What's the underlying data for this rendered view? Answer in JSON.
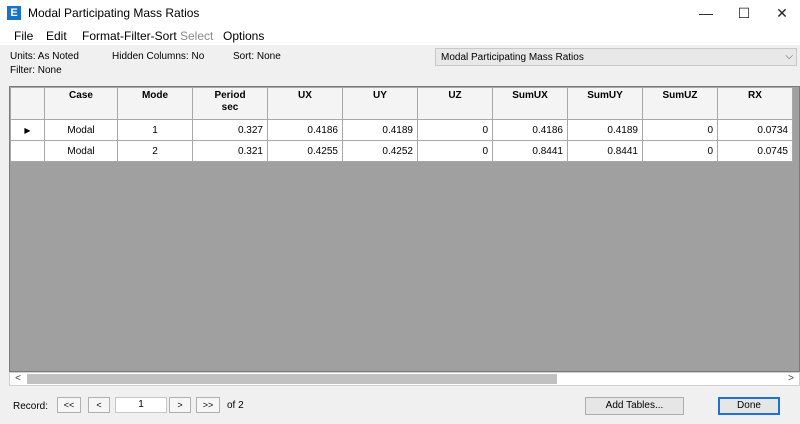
{
  "window": {
    "icon": "E",
    "title": "Modal Participating Mass Ratios",
    "minimize": "—",
    "maximize": "☐",
    "close": "✕"
  },
  "menu": [
    "File",
    "Edit",
    "Format-Filter-Sort",
    "Select",
    "Options"
  ],
  "info": {
    "units": "Units: As Noted",
    "hidden_columns": "Hidden Columns: No",
    "sort": "Sort: None",
    "filter": "Filter: None"
  },
  "table_selector": {
    "selected": "Modal Participating Mass Ratios",
    "arrow": "⌵"
  },
  "table": {
    "headers": [
      {
        "line1": "Case",
        "line2": ""
      },
      {
        "line1": "Mode",
        "line2": ""
      },
      {
        "line1": "Period",
        "line2": "sec"
      },
      {
        "line1": "UX",
        "line2": ""
      },
      {
        "line1": "UY",
        "line2": ""
      },
      {
        "line1": "UZ",
        "line2": ""
      },
      {
        "line1": "SumUX",
        "line2": ""
      },
      {
        "line1": "SumUY",
        "line2": ""
      },
      {
        "line1": "SumUZ",
        "line2": ""
      },
      {
        "line1": "RX",
        "line2": ""
      }
    ],
    "rows": [
      {
        "indicator": "▶",
        "cells": [
          "Modal",
          "1",
          "0.327",
          "0.4186",
          "0.4189",
          "0",
          "0.4186",
          "0.4189",
          "0",
          "0.0734"
        ]
      },
      {
        "indicator": "",
        "cells": [
          "Modal",
          "2",
          "0.321",
          "0.4255",
          "0.4252",
          "0",
          "0.8441",
          "0.8441",
          "0",
          "0.0745"
        ]
      }
    ]
  },
  "scrollbar": {
    "left": "<",
    "right": ">"
  },
  "footer": {
    "record_label": "Record:",
    "first": "<<",
    "prev": "<",
    "record_value": "1",
    "next": ">",
    "last": ">>",
    "of_text": "of 2",
    "add_tables": "Add Tables...",
    "done": "Done"
  }
}
